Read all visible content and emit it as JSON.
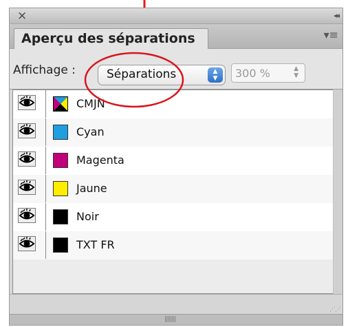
{
  "titlebar": {
    "close_glyph": "×",
    "collapse_glyph": "◂◂"
  },
  "panel": {
    "tab_label": "Aperçu des séparations",
    "menu_glyph": "▾≡"
  },
  "controls": {
    "view_label": "Affichage :",
    "view_select_value": "Séparations",
    "ink_limit_value": "300 %"
  },
  "separations": [
    {
      "name": "CMJN",
      "visible": true,
      "swatch": "cmyk-process"
    },
    {
      "name": "Cyan",
      "visible": true,
      "swatch": "#1e9fe0"
    },
    {
      "name": "Magenta",
      "visible": true,
      "swatch": "#c2007a"
    },
    {
      "name": "Jaune",
      "visible": true,
      "swatch": "#ffed00"
    },
    {
      "name": "Noir",
      "visible": true,
      "swatch": "#000000"
    },
    {
      "name": "TXT FR",
      "visible": true,
      "swatch": "#000000"
    }
  ],
  "annotation_colors": {
    "arrow": "#e8181e",
    "ellipse": "#d9141c"
  }
}
